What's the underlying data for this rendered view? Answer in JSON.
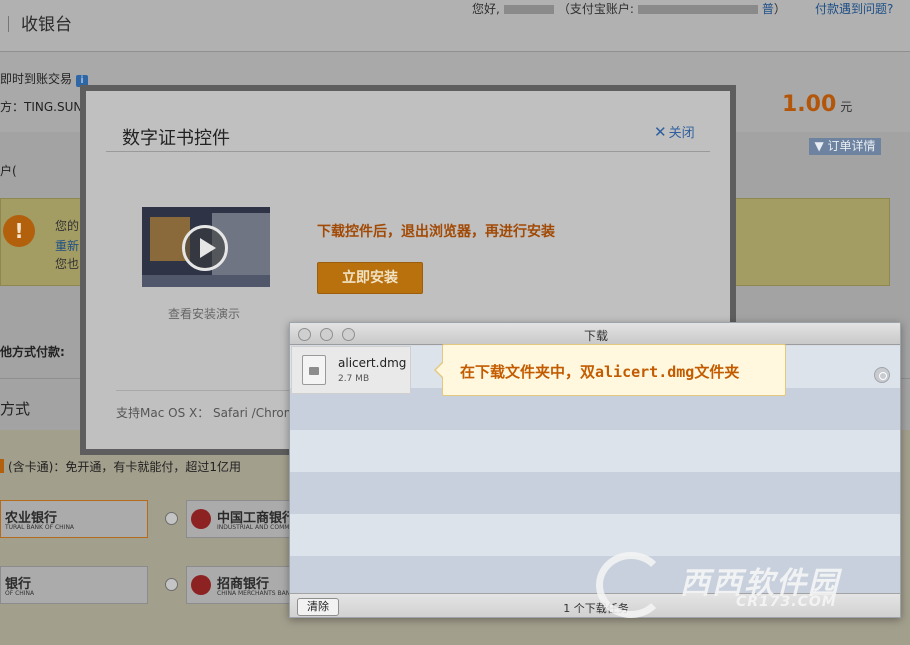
{
  "background_page": {
    "title": "收银台",
    "greeting_prefix": "您好,",
    "account_prefix": "（支付宝账户:",
    "account_suffix": "普",
    "close_paren": "）",
    "help_link": "付款遇到问题?",
    "trade_type": "即时到账交易",
    "payee": "方：TING.SUN",
    "amount": "1.00",
    "amount_unit": "元",
    "order_details": "▼ 订单详情",
    "user_account": "户(",
    "warning_line1": "您的",
    "warning_line2": "重新",
    "warning_line3": "您也",
    "other_payment": "他方式付款:",
    "payment_method_heading": "方式",
    "card_note": "(含卡通)：免开通，有卡就能付，超过1亿用",
    "banks": [
      {
        "name": "农业银行",
        "sub": "TURAL BANK OF CHINA"
      },
      {
        "name": "中国工商银行",
        "sub": "INDUSTRIAL AND COMMERCIAL BANK OF CHINA"
      },
      {
        "name": "银行",
        "sub": "OF CHINA"
      },
      {
        "name": "招商银行",
        "sub": "CHINA MERCHANTS BANK"
      }
    ]
  },
  "modal": {
    "title": "数字证书控件",
    "close_label": "关闭",
    "video_caption": "查看安装演示",
    "hint": "下载控件后，退出浏览器，再进行安装",
    "install_button": "立即安装",
    "support_text": "支持Mac OS X： Safari /Chrom"
  },
  "downloads_window": {
    "title": "下载",
    "file_name": "alicert.dmg",
    "file_size": "2.7 MB",
    "clear_button": "清除",
    "task_count": "1 个下载任务"
  },
  "callout": {
    "text": "在下载文件夹中，双alicert.dmg文件夹"
  },
  "watermark": {
    "text": "西西软件园",
    "url": "CR173.COM"
  }
}
